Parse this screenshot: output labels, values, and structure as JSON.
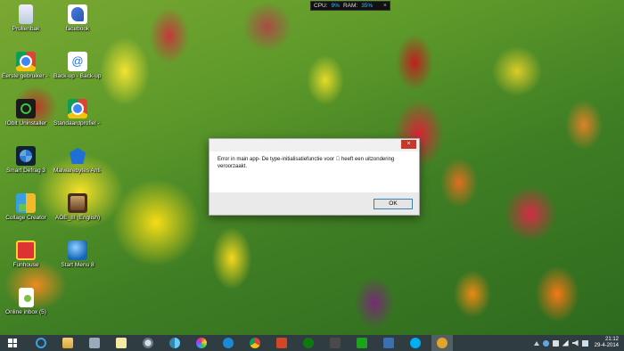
{
  "performance": {
    "cpu_label": "CPU:",
    "cpu_value": "9%",
    "ram_label": "RAM:",
    "ram_value": "35%",
    "close": "×"
  },
  "desktop_icons": [
    {
      "label": "Prullenbak",
      "icon": "recycle-bin-icon"
    },
    {
      "label": "facebook",
      "icon": "facebook-icon"
    },
    {
      "label": "Eerste gebruiker - Chrome",
      "icon": "chrome-icon"
    },
    {
      "label": "Back-up - Back-up ...",
      "icon": "backup-icon"
    },
    {
      "label": "IObit Uninstaller",
      "icon": "iobit-uninstaller-icon"
    },
    {
      "label": "Standaardprofiel - Chrome",
      "icon": "chrome-icon"
    },
    {
      "label": "Smart Defrag 3",
      "icon": "smart-defrag-icon"
    },
    {
      "label": "Malwarebytes Anti-Malware",
      "icon": "malwarebytes-icon"
    },
    {
      "label": "Collage Creator",
      "icon": "collage-creator-icon"
    },
    {
      "label": "AOE_III (English)",
      "icon": "age-of-empires-icon"
    },
    {
      "label": "Funhouse",
      "icon": "funhouse-icon"
    },
    {
      "label": "Start Menu 8",
      "icon": "start-menu-8-icon"
    },
    {
      "label": "Online inbox (5)",
      "icon": "online-inbox-icon"
    }
  ],
  "dialog": {
    "close": "×",
    "message": "Error in main app- De type-initialisatiefunctie voor \u0000 heeft een uitzondering veroorzaakt.",
    "ok_label": "OK"
  },
  "taskbar": {
    "apps": [
      "internet-explorer-icon",
      "file-explorer-icon",
      "monitor-icon",
      "sticky-notes-icon",
      "people-icon",
      "network-icon",
      "picasa-icon",
      "ccleaner-icon",
      "chrome-icon",
      "powerpoint-icon",
      "xbox-icon",
      "video-icon",
      "store-icon",
      "app-icon",
      "skype-icon",
      "app-active-icon"
    ],
    "time": "21:12",
    "date": "29-4-2014"
  }
}
